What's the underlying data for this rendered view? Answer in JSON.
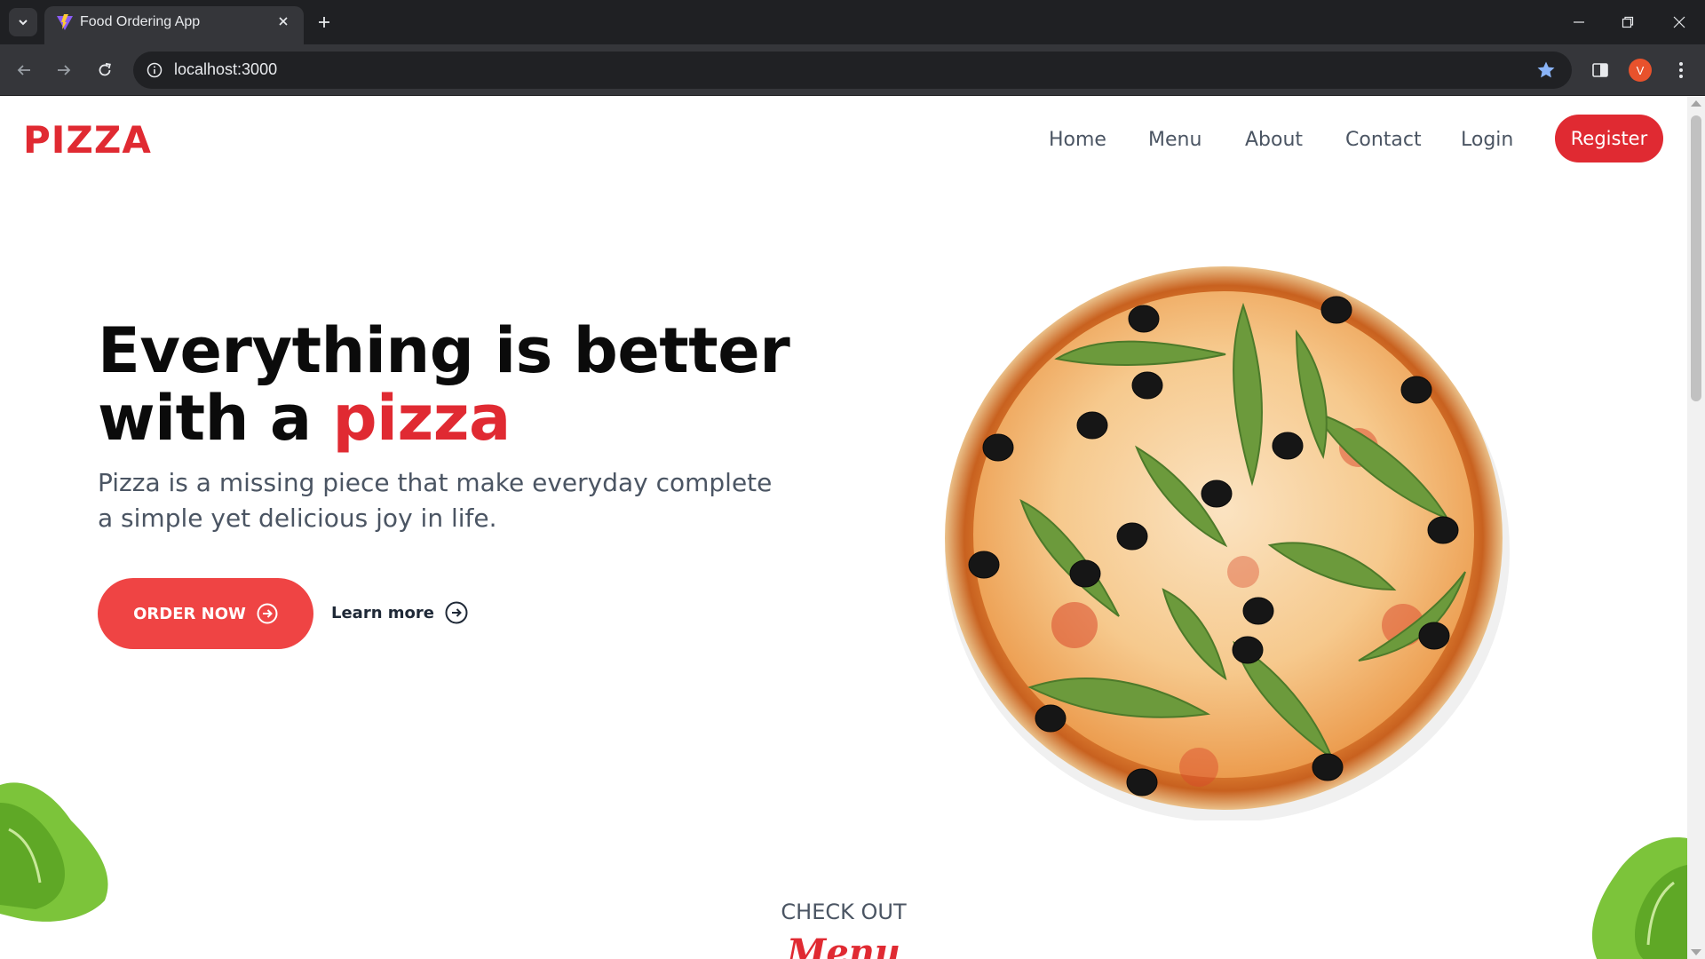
{
  "browser": {
    "tab_title": "Food Ordering App",
    "url": "localhost:3000",
    "profile_initial": "V"
  },
  "navbar": {
    "brand": "PIZZA",
    "links": [
      "Home",
      "Menu",
      "About",
      "Contact",
      "Login"
    ],
    "register_label": "Register"
  },
  "hero": {
    "title_line1": "Everything is better",
    "title_line2_prefix": "with a ",
    "title_accent": "pizza",
    "subtitle": "Pizza is a missing piece that make everyday complete a simple yet delicious joy in life.",
    "order_label": "ORDER NOW",
    "learn_label": "Learn more"
  },
  "menu_section": {
    "kicker": "CHECK OUT",
    "heading": "Menu"
  },
  "colors": {
    "brand_red": "#e02a32",
    "button_red": "#ef4444",
    "text_gray": "#4b5563"
  }
}
